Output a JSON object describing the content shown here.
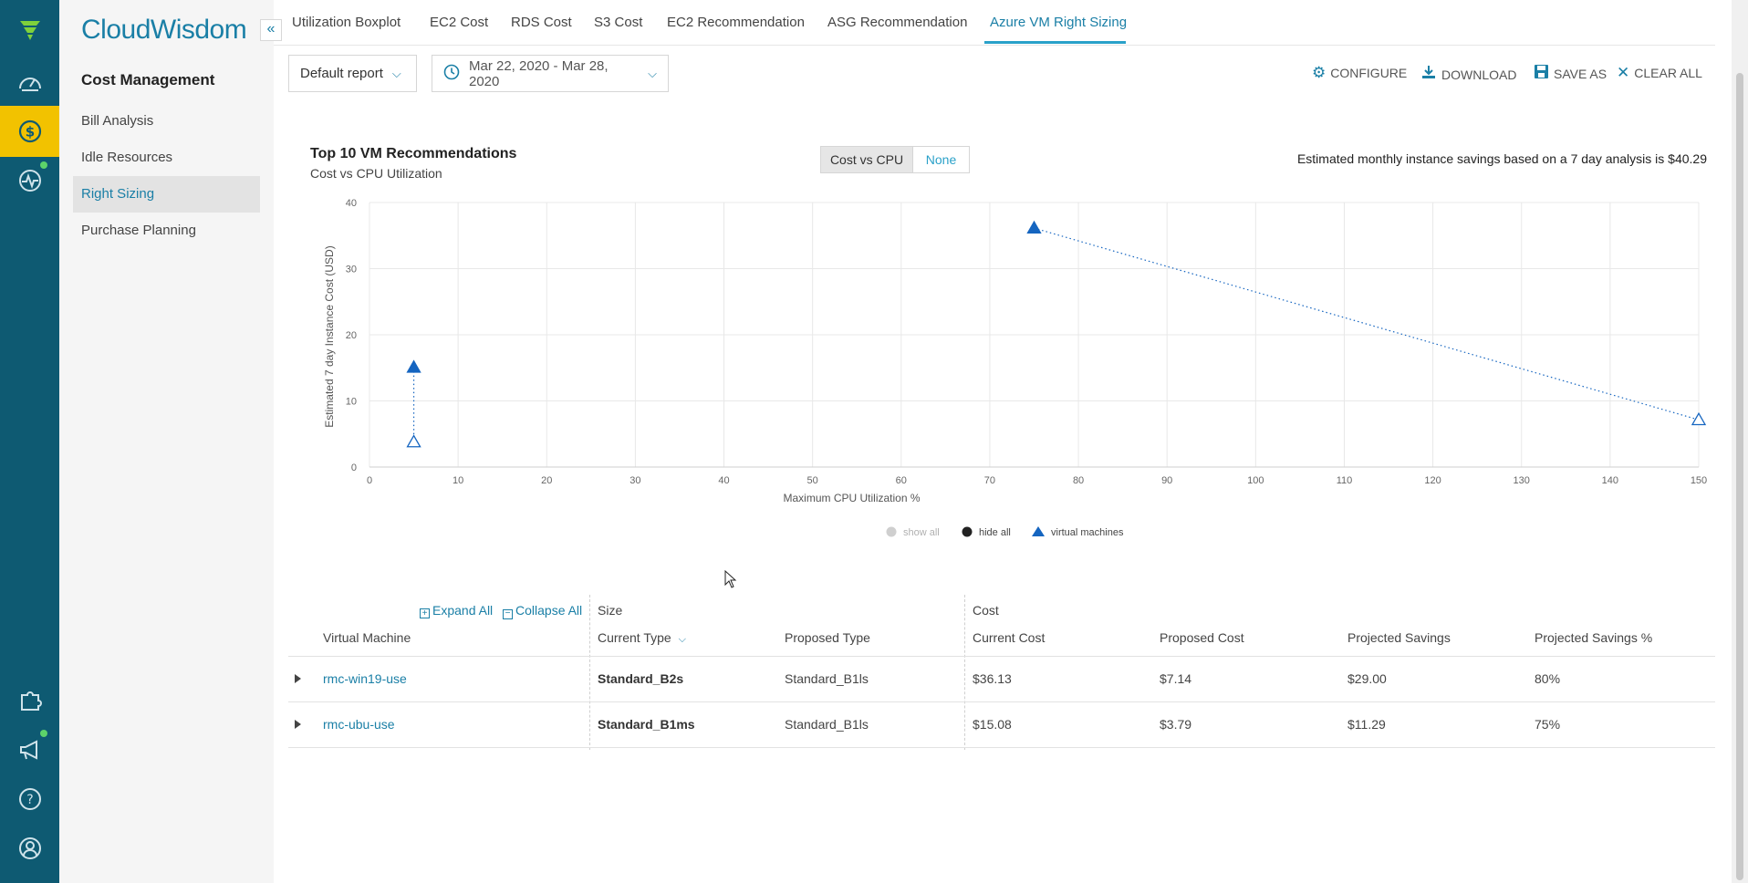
{
  "sidebar": {
    "brand": "CloudWisdom",
    "collapse_label": "«",
    "section_title": "Cost Management",
    "items": [
      {
        "label": "Bill Analysis"
      },
      {
        "label": "Idle Resources"
      },
      {
        "label": "Right Sizing",
        "active": true
      },
      {
        "label": "Purchase Planning"
      }
    ]
  },
  "tabs": [
    {
      "label": "Utilization Boxplot"
    },
    {
      "label": "EC2 Cost"
    },
    {
      "label": "RDS Cost"
    },
    {
      "label": "S3 Cost"
    },
    {
      "label": "EC2 Recommendation"
    },
    {
      "label": "ASG Recommendation"
    },
    {
      "label": "Azure VM Right Sizing",
      "active": true
    }
  ],
  "filters": {
    "report": "Default report",
    "date_range": "Mar 22, 2020 - Mar 28, 2020"
  },
  "toolbar": {
    "configure": "CONFIGURE",
    "download": "DOWNLOAD",
    "save_as": "SAVE AS",
    "clear_all": "CLEAR ALL"
  },
  "chart_header": {
    "title": "Top 10 VM Recommendations",
    "subtitle": "Cost vs CPU Utilization",
    "toggle_on": "Cost vs CPU",
    "toggle_off": "None",
    "savings_text": "Estimated monthly instance savings based on a 7 day analysis is $40.29"
  },
  "chart_data": {
    "type": "scatter",
    "xlabel": "Maximum CPU Utilization %",
    "ylabel": "Estimated 7 day Instance Cost (USD)",
    "xlim": [
      0,
      150
    ],
    "ylim": [
      0,
      40
    ],
    "xticks": [
      0,
      10,
      20,
      30,
      40,
      50,
      60,
      70,
      80,
      90,
      100,
      110,
      120,
      130,
      140,
      150
    ],
    "yticks": [
      0,
      10,
      20,
      30,
      40
    ],
    "grid": true,
    "legend": [
      "show all",
      "hide all",
      "virtual machines"
    ],
    "legend_position": "bottom",
    "series_color": "#1565c0",
    "pairs": [
      {
        "current": {
          "x": 75,
          "y": 36.13
        },
        "proposed": {
          "x": 150,
          "y": 7.14
        }
      },
      {
        "current": {
          "x": 5,
          "y": 15.08
        },
        "proposed": {
          "x": 5,
          "y": 3.79
        }
      }
    ]
  },
  "table": {
    "expand_all": "Expand All",
    "collapse_all": "Collapse All",
    "group_size": "Size",
    "group_cost": "Cost",
    "columns": [
      "Virtual Machine",
      "Current Type",
      "Proposed Type",
      "Current Cost",
      "Proposed Cost",
      "Projected Savings",
      "Projected Savings %"
    ],
    "rows": [
      [
        "rmc-win19-use",
        "Standard_B2s",
        "Standard_B1ls",
        "$36.13",
        "$7.14",
        "$29.00",
        "80%"
      ],
      [
        "rmc-ubu-use",
        "Standard_B1ms",
        "Standard_B1ls",
        "$15.08",
        "$3.79",
        "$11.29",
        "75%"
      ]
    ]
  }
}
